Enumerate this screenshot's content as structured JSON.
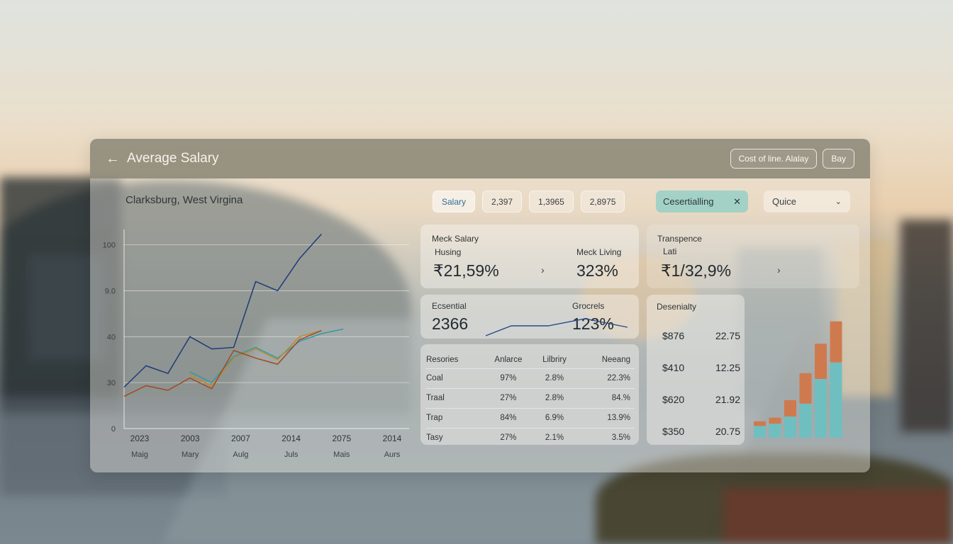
{
  "header": {
    "title": "Average Salary",
    "actions": [
      "Cost of line.  Alalay",
      "Bay"
    ]
  },
  "location": "Clarksburg, West Virgina",
  "filters": {
    "pills": [
      "Salary",
      "2,397",
      "1,3965",
      "2,8975"
    ],
    "chip": "Cesertialling",
    "select": "Quice"
  },
  "cards": {
    "salary": {
      "label1": "Meck Salary",
      "label2": "Husing",
      "value": "₹21,59%"
    },
    "living": {
      "label": "Meck Living",
      "value": "323%"
    },
    "transpence": {
      "label1": "Transpence",
      "label2": "Lati",
      "value": "₹1/32,9%"
    },
    "essential": {
      "label": "Ecsential",
      "value": "2366"
    },
    "groceries": {
      "label": "Grocrels",
      "value": "123%"
    },
    "desirability": {
      "label": "Desenialty",
      "rows": [
        [
          "$876",
          "22.75"
        ],
        [
          "$410",
          "12.25"
        ],
        [
          "$620",
          "21.92"
        ],
        [
          "$350",
          "20.75"
        ]
      ]
    }
  },
  "table": {
    "headers": [
      "Resories",
      "Anlarce",
      "Lilbriry",
      "Neeang"
    ],
    "rows": [
      [
        "Coal",
        "97%",
        "2.8%",
        "22.3%"
      ],
      [
        "Traal",
        "27%",
        "2.8%",
        "84.%"
      ],
      [
        "Trap",
        "84%",
        "6.9%",
        "13.9%"
      ],
      [
        "Tasy",
        "27%",
        "2.1%",
        "3.5%"
      ]
    ]
  },
  "chart_data": [
    {
      "type": "line",
      "title": "",
      "xlabel": "",
      "ylabel": "",
      "y_tick_labels": [
        "0",
        "30",
        "40",
        "9.0",
        "100"
      ],
      "x_tick_labels": [
        "2023",
        "2003",
        "2007",
        "2014",
        "2075",
        "2014"
      ],
      "x_sub_labels": [
        "Maig",
        "Mary",
        "Aulg",
        "Juls",
        "Mais",
        "Aurs"
      ],
      "ylim": [
        0,
        130
      ],
      "x": [
        0,
        1,
        2,
        3,
        4,
        5,
        6,
        7,
        8,
        9,
        10,
        11,
        12,
        13
      ],
      "series": [
        {
          "color": "#1f3a78",
          "values": [
            27,
            41,
            36,
            60,
            52,
            53,
            96,
            90,
            111,
            127,
            0,
            0,
            0,
            0
          ]
        },
        {
          "color": "#2f9aa8",
          "values": [
            0,
            0,
            0,
            37,
            30,
            47,
            53,
            46,
            57,
            62,
            65,
            0,
            0,
            0
          ]
        },
        {
          "color": "#c08a2c",
          "values": [
            0,
            0,
            0,
            35,
            28,
            46,
            52,
            45,
            60,
            64,
            0,
            0,
            0,
            0
          ]
        },
        {
          "color": "#a24a22",
          "values": [
            21,
            28,
            25,
            33,
            26,
            51,
            46,
            42,
            58,
            64,
            0,
            0,
            0,
            0
          ]
        }
      ]
    },
    {
      "type": "bar",
      "title": "",
      "stacked": true,
      "colors": {
        "lower": "#6fbfc0",
        "upper": "#cf7a4e"
      },
      "categories": [
        "1",
        "2",
        "3",
        "4",
        "5",
        "6"
      ],
      "series": [
        {
          "values": [
            10,
            12,
            18,
            29,
            50,
            64
          ]
        },
        {
          "values": [
            4,
            5,
            14,
            26,
            30,
            35
          ]
        }
      ]
    }
  ]
}
